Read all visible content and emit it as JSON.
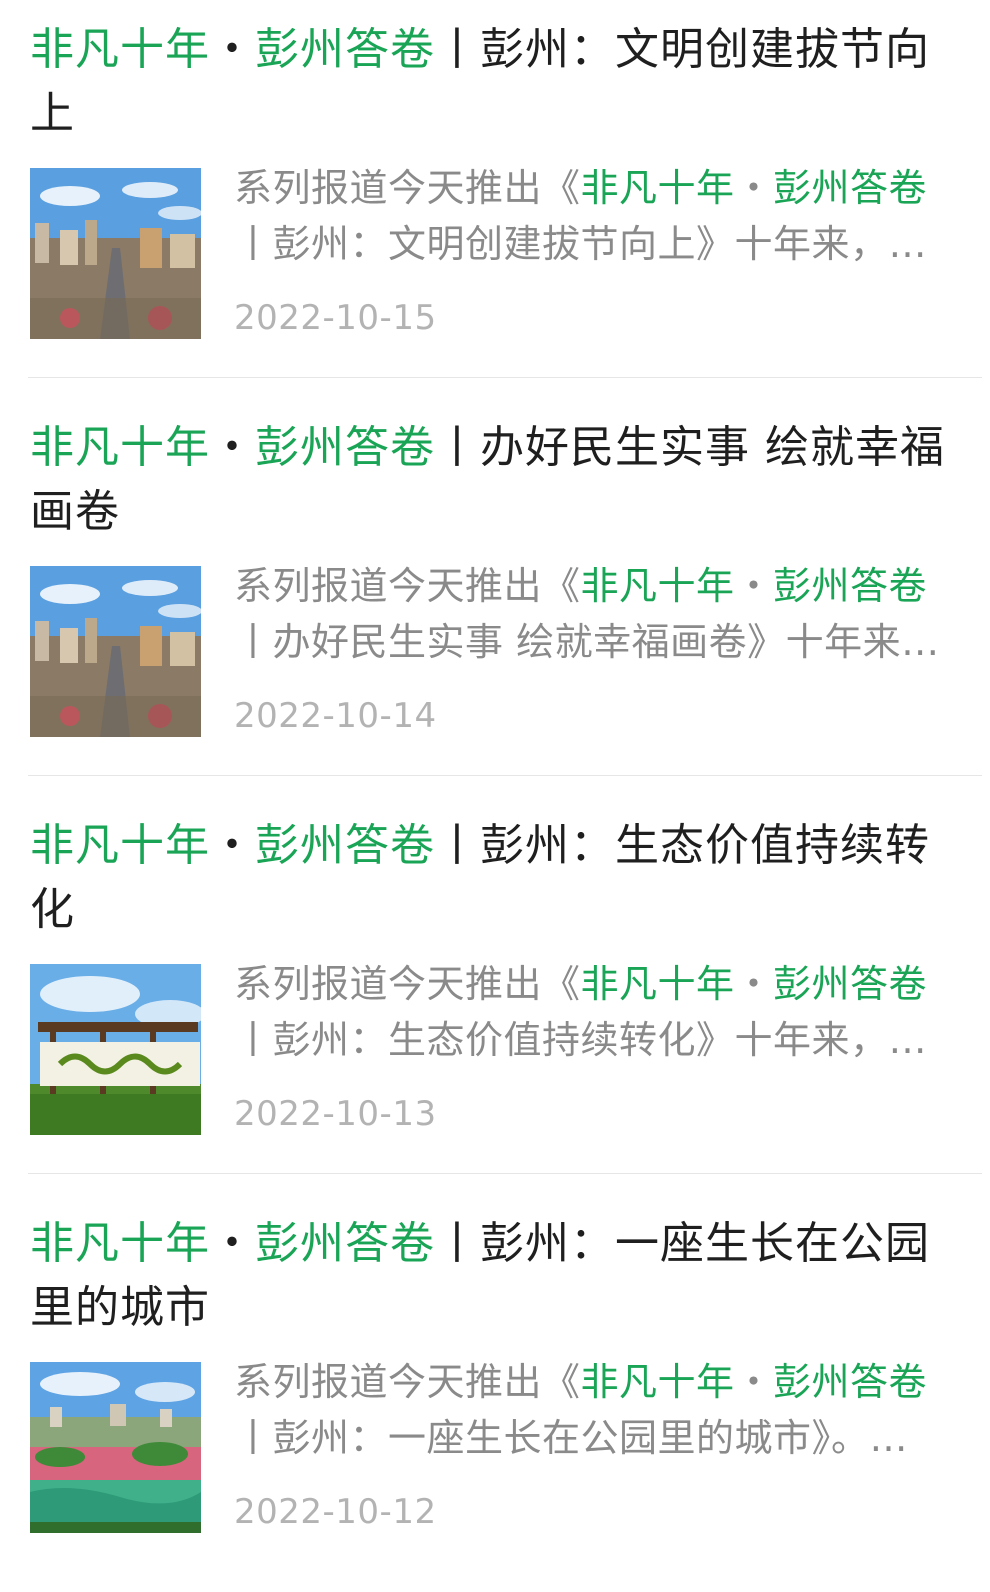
{
  "articles": [
    {
      "title_hl": "非凡十年",
      "title_dot": "・",
      "title_hl2": "彭州答卷",
      "title_rest": "丨彭州：文明创建拔节向上",
      "summary_prefix": "系列报道今天推出《",
      "summary_hl": "非凡十年",
      "summary_dot": "・",
      "summary_hl2": "彭州答卷",
      "summary_line2": "丨彭州：文明创建拔节向上》十年来，…",
      "date": "2022-10-15",
      "thumb_icon": "city-aerial-image"
    },
    {
      "title_hl": "非凡十年",
      "title_dot": "・",
      "title_hl2": "彭州答卷",
      "title_rest": "丨办好民生实事 绘就幸福画卷",
      "summary_prefix": "系列报道今天推出《",
      "summary_hl": "非凡十年",
      "summary_dot": "・",
      "summary_hl2": "彭州答卷",
      "summary_line2": "丨办好民生实事 绘就幸福画卷》十年来…",
      "date": "2022-10-14",
      "thumb_icon": "city-aerial-image"
    },
    {
      "title_hl": "非凡十年",
      "title_dot": "・",
      "title_hl2": "彭州答卷",
      "title_rest": "丨彭州：生态价值持续转化",
      "summary_prefix": "系列报道今天推出《",
      "summary_hl": "非凡十年",
      "summary_dot": "・",
      "summary_hl2": "彭州答卷",
      "summary_line2": "丨彭州：生态价值持续转化》十年来，…",
      "date": "2022-10-13",
      "thumb_icon": "rural-signboard-image"
    },
    {
      "title_hl": "非凡十年",
      "title_dot": "・",
      "title_hl2": "彭州答卷",
      "title_rest": "丨彭州：一座生长在公园里的城市",
      "summary_prefix": "系列报道今天推出《",
      "summary_hl": "非凡十年",
      "summary_dot": "・",
      "summary_hl2": "彭州答卷",
      "summary_line2": "丨彭州：一座生长在公园里的城市》。…",
      "date": "2022-10-12",
      "thumb_icon": "park-lake-image"
    }
  ],
  "colors": {
    "accent": "#1aa556",
    "summary": "#8a8a8a",
    "date": "#b3b3b3"
  }
}
